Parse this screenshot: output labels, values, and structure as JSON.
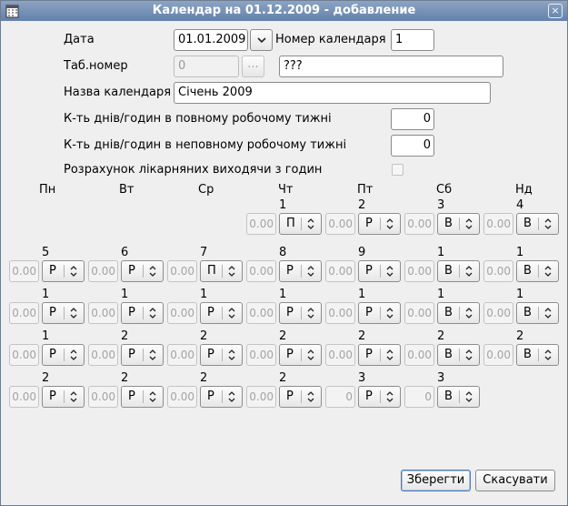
{
  "window": {
    "title": "Календар на 01.12.2009 - добавление",
    "close_glyph": "×"
  },
  "form": {
    "date_label": "Дата",
    "date_value": "01.01.2009",
    "calendar_number_label": "Номер календаря",
    "calendar_number_value": "1",
    "tab_number_label": "Таб.номер",
    "tab_number_value": "0",
    "tab_lookup_label": "...",
    "tab_name_value": "???",
    "calendar_name_label": "Назва календаря",
    "calendar_name_value": "Січень 2009",
    "full_week_label": "К-ть днів/годин в повному робочому тижні",
    "full_week_value": "0",
    "partial_week_label": "К-ть днів/годин в неповному робочому тижні",
    "partial_week_value": "0",
    "sick_leave_label": "Розрахунок лікарняних виходячи з годин",
    "sick_leave_checked": false
  },
  "weekdays": [
    "Пн",
    "Вт",
    "Ср",
    "Чт",
    "Пт",
    "Сб",
    "Нд"
  ],
  "calendar": {
    "rows": [
      [
        null,
        null,
        null,
        {
          "day": "1",
          "hours": "0.00",
          "type": "П"
        },
        {
          "day": "2",
          "hours": "0.00",
          "type": "Р"
        },
        {
          "day": "3",
          "hours": "0.00",
          "type": "В"
        },
        {
          "day": "4",
          "hours": "0.00",
          "type": "В"
        }
      ],
      [
        {
          "day": "5",
          "hours": "0.00",
          "type": "Р"
        },
        {
          "day": "6",
          "hours": "0.00",
          "type": "Р"
        },
        {
          "day": "7",
          "hours": "0.00",
          "type": "П"
        },
        {
          "day": "8",
          "hours": "0.00",
          "type": "Р"
        },
        {
          "day": "9",
          "hours": "0.00",
          "type": "Р"
        },
        {
          "day": "1",
          "hours": "0.00",
          "type": "В"
        },
        {
          "day": "1",
          "hours": "0.00",
          "type": "В"
        }
      ],
      [
        {
          "day": "1",
          "hours": "0.00",
          "type": "Р"
        },
        {
          "day": "1",
          "hours": "0.00",
          "type": "Р"
        },
        {
          "day": "1",
          "hours": "0.00",
          "type": "Р"
        },
        {
          "day": "1",
          "hours": "0.00",
          "type": "Р"
        },
        {
          "day": "1",
          "hours": "0.00",
          "type": "Р"
        },
        {
          "day": "1",
          "hours": "0.00",
          "type": "В"
        },
        {
          "day": "1",
          "hours": "0.00",
          "type": "В"
        }
      ],
      [
        {
          "day": "1",
          "hours": "0.00",
          "type": "Р"
        },
        {
          "day": "2",
          "hours": "0.00",
          "type": "Р"
        },
        {
          "day": "2",
          "hours": "0.00",
          "type": "Р"
        },
        {
          "day": "2",
          "hours": "0.00",
          "type": "Р"
        },
        {
          "day": "2",
          "hours": "0.00",
          "type": "Р"
        },
        {
          "day": "2",
          "hours": "0.00",
          "type": "В"
        },
        {
          "day": "2",
          "hours": "0.00",
          "type": "В"
        }
      ],
      [
        {
          "day": "2",
          "hours": "0.00",
          "type": "Р"
        },
        {
          "day": "2",
          "hours": "0.00",
          "type": "Р"
        },
        {
          "day": "2",
          "hours": "0.00",
          "type": "Р"
        },
        {
          "day": "2",
          "hours": "0.00",
          "type": "Р"
        },
        {
          "day": "3",
          "hours": "0",
          "type": "Р"
        },
        {
          "day": "3",
          "hours": "0",
          "type": "В"
        },
        null
      ]
    ]
  },
  "buttons": {
    "save": "Зберегти",
    "cancel": "Скасувати"
  }
}
